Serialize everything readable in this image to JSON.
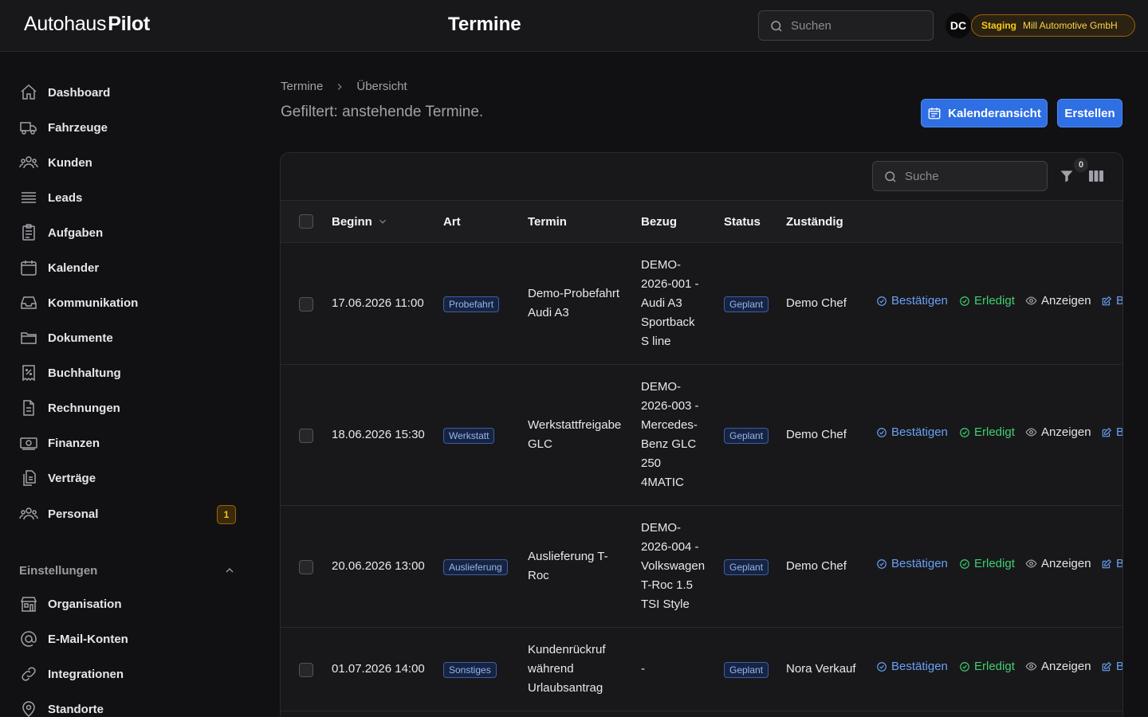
{
  "app": {
    "logo_part1": "Autohaus",
    "logo_part2": "Pilot",
    "page_title": "Termine"
  },
  "header": {
    "search_placeholder": "Suchen",
    "avatar_initials": "DC",
    "env_label": "Staging",
    "org_name": "Mill Automotive GmbH"
  },
  "sidebar": {
    "items": [
      {
        "label": "Dashboard",
        "icon": "home-icon"
      },
      {
        "label": "Fahrzeuge",
        "icon": "truck-icon"
      },
      {
        "label": "Kunden",
        "icon": "users-icon"
      },
      {
        "label": "Leads",
        "icon": "stack-icon"
      },
      {
        "label": "Aufgaben",
        "icon": "clipboard-icon"
      },
      {
        "label": "Kalender",
        "icon": "calendar-icon"
      },
      {
        "label": "Kommunikation",
        "icon": "inbox-icon"
      },
      {
        "label": "Dokumente",
        "icon": "folder-icon"
      },
      {
        "label": "Buchhaltung",
        "icon": "receipt-percent-icon"
      },
      {
        "label": "Rechnungen",
        "icon": "document-icon"
      },
      {
        "label": "Finanzen",
        "icon": "banknotes-icon"
      },
      {
        "label": "Verträge",
        "icon": "documents-icon"
      },
      {
        "label": "Personal",
        "icon": "users-icon",
        "badge": "1"
      }
    ],
    "settings_title": "Einstellungen",
    "settings_items": [
      {
        "label": "Organisation",
        "icon": "building-icon"
      },
      {
        "label": "E-Mail-Konten",
        "icon": "at-icon"
      },
      {
        "label": "Integrationen",
        "icon": "link-icon"
      },
      {
        "label": "Standorte",
        "icon": "map-pin-icon"
      }
    ]
  },
  "main": {
    "breadcrumb": [
      "Termine",
      "Übersicht"
    ],
    "subtitle": "Gefiltert: anstehende Termine.",
    "calendar_button": "Kalenderansicht",
    "create_button": "Erstellen"
  },
  "table": {
    "search_placeholder": "Suche",
    "filter_count": "0",
    "columns": [
      "Beginn",
      "Art",
      "Termin",
      "Bezug",
      "Status",
      "Zuständig"
    ],
    "actions": {
      "confirm": "Bestätigen",
      "done": "Erledigt",
      "view": "Anzeigen",
      "edit_partial": "B"
    },
    "rows": [
      {
        "beginn": "17.06.2026 11:00",
        "art": "Probefahrt",
        "termin": [
          "Demo-Probefahrt",
          "Audi A3"
        ],
        "bezug": [
          "DEMO-",
          "2026-001 -",
          "Audi A3",
          "Sportback",
          "S line"
        ],
        "status": "Geplant",
        "zustaendig": "Demo Chef"
      },
      {
        "beginn": "18.06.2026 15:30",
        "art": "Werkstatt",
        "termin": [
          "Werkstattfreigabe",
          "GLC"
        ],
        "bezug": [
          "DEMO-",
          "2026-003 -",
          "Mercedes-",
          "Benz GLC",
          "250",
          "4MATIC"
        ],
        "status": "Geplant",
        "zustaendig": "Demo Chef"
      },
      {
        "beginn": "20.06.2026 13:00",
        "art": "Auslieferung",
        "termin": [
          "Auslieferung T-",
          "Roc"
        ],
        "bezug": [
          "DEMO-",
          "2026-004 -",
          "Volkswagen",
          "T-Roc 1.5",
          "TSI Style"
        ],
        "status": "Geplant",
        "zustaendig": "Demo Chef"
      },
      {
        "beginn": "01.07.2026 14:00",
        "art": "Sonstiges",
        "termin": [
          "Kundenrückruf",
          "während",
          "Urlaubsantrag"
        ],
        "bezug": [
          "-"
        ],
        "status": "Geplant",
        "zustaendig": "Nora Verkauf"
      }
    ]
  }
}
